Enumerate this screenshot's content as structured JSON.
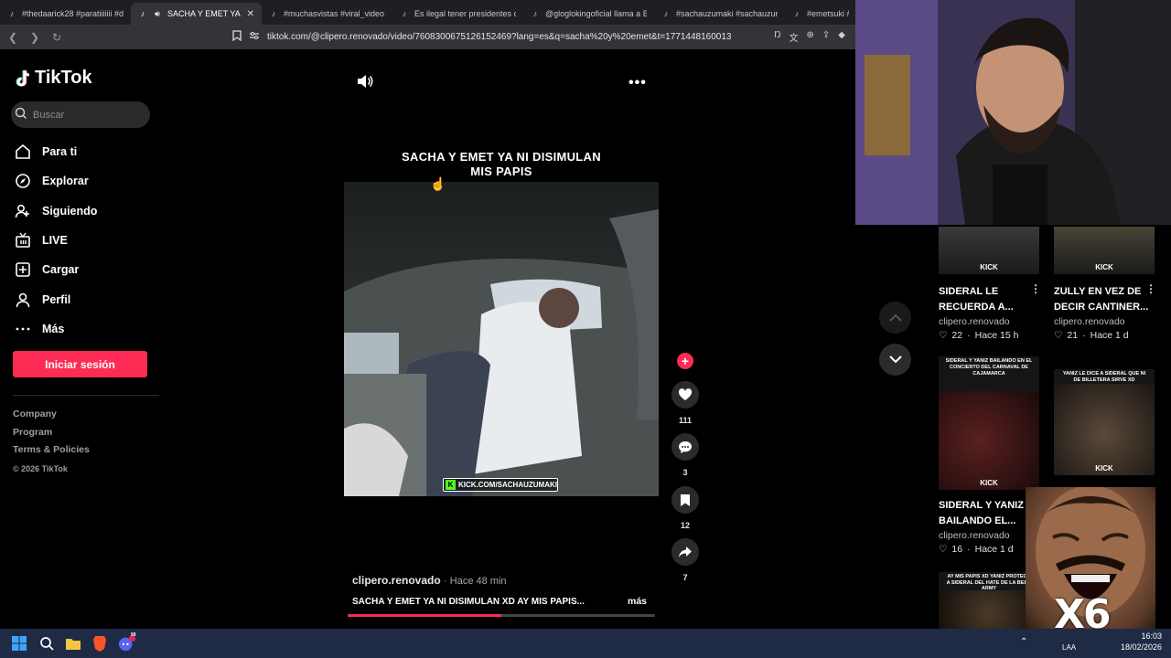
{
  "browser": {
    "tabs": [
      {
        "title": "#thedaarick28 #parati​iiiiii #daa",
        "active": false
      },
      {
        "title": "SACHA Y EMET YA NI D",
        "active": true
      },
      {
        "title": "#muchasvistas #viral_video #p",
        "active": false
      },
      {
        "title": "Es ilegal tener presidentes con",
        "active": false
      },
      {
        "title": "@glogl​okingoficial llama a Bu",
        "active": false
      },
      {
        "title": "#sachauzumaki #sachauzumak",
        "active": false
      },
      {
        "title": "#emetsuki #sac",
        "active": false
      }
    ],
    "url": "tiktok.com/@clipero.renovado/video/7608300675126152469?lang=es&q=sacha%20y%20emet&t=1771448160013"
  },
  "sidebar": {
    "logo": "TikTok",
    "search_placeholder": "Buscar",
    "items": [
      {
        "label": "Para ti",
        "icon": "home-icon"
      },
      {
        "label": "Explorar",
        "icon": "compass-icon"
      },
      {
        "label": "Siguiendo",
        "icon": "following-icon"
      },
      {
        "label": "LIVE",
        "icon": "live-icon"
      },
      {
        "label": "Cargar",
        "icon": "upload-icon"
      },
      {
        "label": "Perfil",
        "icon": "profile-icon"
      },
      {
        "label": "Más",
        "icon": "more-icon"
      }
    ],
    "login_label": "Iniciar sesión",
    "footer_links": [
      "Company",
      "Program",
      "Terms & Policies"
    ],
    "copyright": "© 2026 TikTok"
  },
  "video": {
    "caption_line1": "SACHA Y EMET YA NI DISIMULAN",
    "caption_line2": "MIS PAPIS",
    "stream_tag": "KICK.COM/SACHAUZUMAKI",
    "likes": "111",
    "comments": "3",
    "saves": "12",
    "shares": "7",
    "author": "clipero.renovado",
    "time": "· Hace 48 min",
    "description": "SACHA Y EMET YA NI DISIMULAN XD AY MIS PAPIS...",
    "more_label": "más",
    "progress": 0.5
  },
  "related": [
    {
      "title": "SIDERAL LE RECUERDA A...",
      "author": "clipero.renovado",
      "likes": "22",
      "time": "Hace 15 h",
      "kick": "KICK"
    },
    {
      "title": "ZULLY EN VEZ DE DECIR CANTINER...",
      "author": "clipero.renovado",
      "likes": "21",
      "time": "Hace 1 d",
      "kick": "KICK"
    },
    {
      "title": "SIDERAL Y YANIZ BAILANDO EL...",
      "author": "clipero.renovado",
      "likes": "16",
      "time": "Hace 1 d",
      "kick": "KICK",
      "overlay": "SIDERAL Y YANIZ BAILANDO EN EL CONCIERTO DEL CARNAVAL DE CAJAMARCA"
    },
    {
      "title": "",
      "author": "",
      "likes": "",
      "time": "",
      "kick": "KICK",
      "overlay": "YANIZ LE DICE A SIDERAL QUE NI DE BILLETERA SIRVE XD"
    },
    {
      "title": "",
      "author": "",
      "likes": "",
      "time": "",
      "kick": "",
      "overlay": "AY MIS PAPIS XD YANIZ PROTEGE A SIDERAL DEL HATE DE LA BEBA ARMY"
    }
  ],
  "meme": {
    "text": "X6"
  },
  "taskbar": {
    "time": "16:03",
    "date": "18/02/2026",
    "lang": "LAA",
    "discord_badge": "99"
  },
  "colors": {
    "accent": "#fe2c55",
    "kick_green": "#53fc18",
    "taskbar": "#1f2a44"
  }
}
